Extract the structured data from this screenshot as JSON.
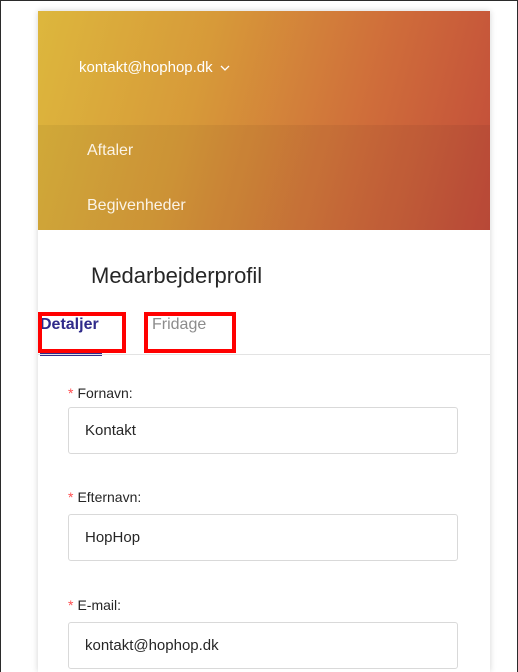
{
  "header": {
    "account_email": "kontakt@hophop.dk",
    "nav": [
      {
        "label": "Aftaler"
      },
      {
        "label": "Begivenheder"
      }
    ]
  },
  "page": {
    "title": "Medarbejderprofil"
  },
  "tabs": [
    {
      "label": "Detaljer",
      "active": true
    },
    {
      "label": "Fridage",
      "active": false
    }
  ],
  "form": {
    "first_name": {
      "label": "Fornavn:",
      "value": "Kontakt",
      "required_mark": "*"
    },
    "last_name": {
      "label": "Efternavn:",
      "value": "HopHop",
      "required_mark": "*"
    },
    "email": {
      "label": "E-mail:",
      "value": "kontakt@hophop.dk",
      "required_mark": "*"
    }
  },
  "colors": {
    "gradient_start": "#ddb73d",
    "gradient_end": "#c24c3a",
    "active_tab": "#2f2a8a",
    "required": "#ff4d4f",
    "highlight": "#ff0000"
  }
}
